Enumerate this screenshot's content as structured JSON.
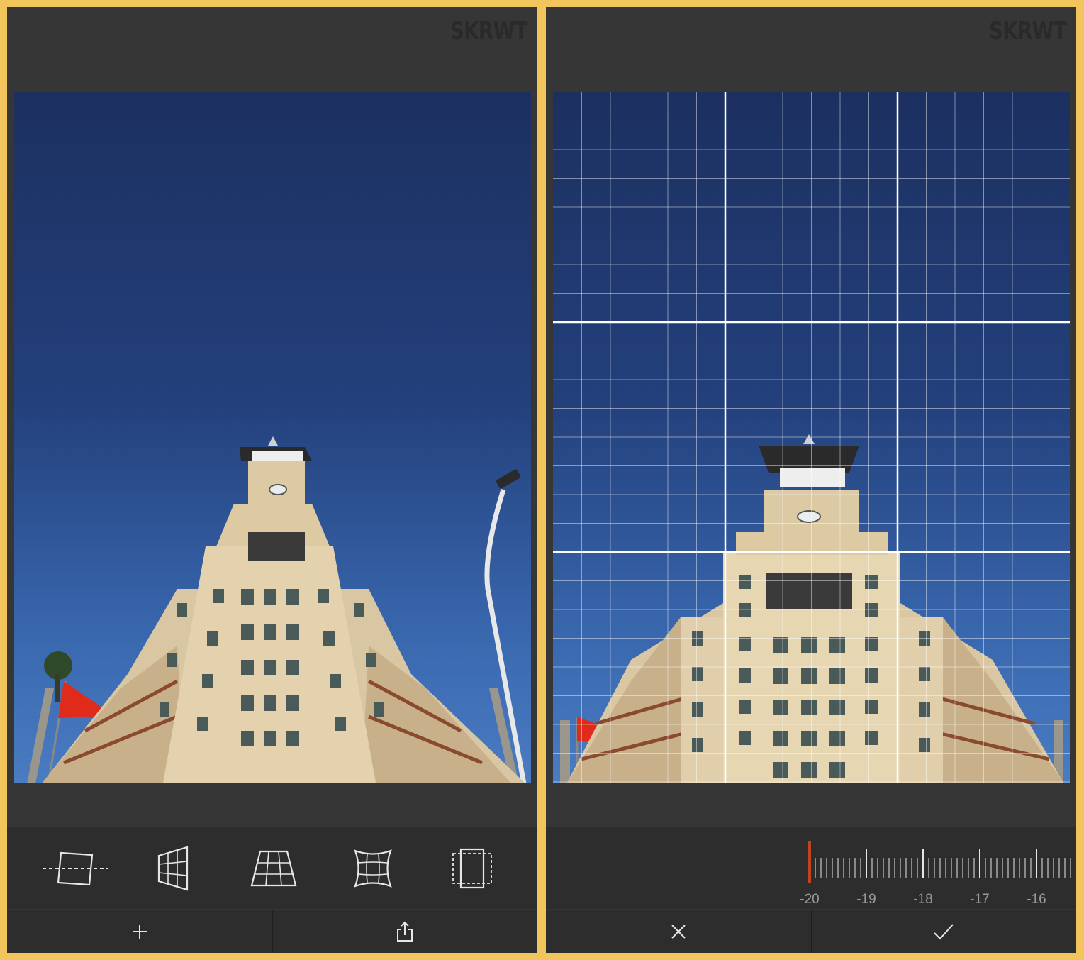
{
  "app": {
    "logo_text": "SKRWT"
  },
  "left_screen": {
    "tools": [
      {
        "name": "rotate-tool",
        "icon": "rotate-frame-icon"
      },
      {
        "name": "horizontal-perspective-tool",
        "icon": "horizontal-perspective-icon"
      },
      {
        "name": "vertical-perspective-tool",
        "icon": "vertical-perspective-icon"
      },
      {
        "name": "lens-distortion-tool",
        "icon": "lens-distortion-icon"
      },
      {
        "name": "crop-tool",
        "icon": "crop-frame-icon"
      }
    ],
    "bottom_actions": [
      {
        "name": "add-button",
        "icon": "plus-icon"
      },
      {
        "name": "share-button",
        "icon": "share-icon"
      }
    ]
  },
  "right_screen": {
    "slider": {
      "value": -20,
      "labels": [
        "-20",
        "-19",
        "-18",
        "-17",
        "-16"
      ],
      "indicator_color": "#c0451e"
    },
    "bottom_actions": [
      {
        "name": "cancel-button",
        "icon": "close-icon"
      },
      {
        "name": "confirm-button",
        "icon": "checkmark-icon"
      }
    ]
  },
  "colors": {
    "frame": "#f2c55c",
    "background": "#363636",
    "toolbar": "#2d2d2d"
  }
}
